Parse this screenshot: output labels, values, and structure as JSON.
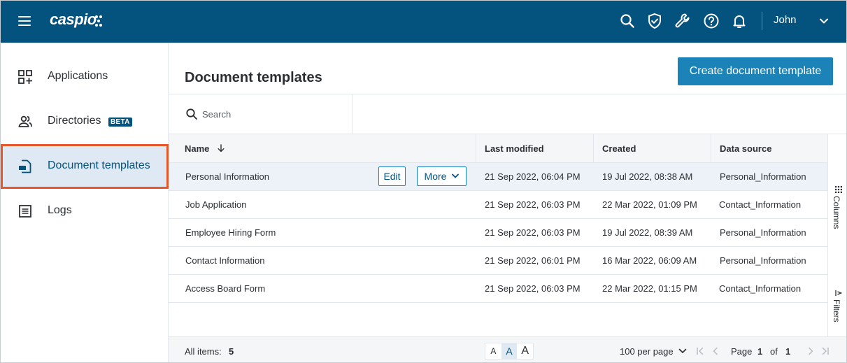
{
  "topbar": {
    "logo": "caspio",
    "icons": [
      "search-icon",
      "shield-check-icon",
      "wrench-icon",
      "help-icon",
      "bell-icon"
    ],
    "user_name": "John"
  },
  "sidebar": {
    "items": [
      {
        "label": "Applications",
        "icon": "apps-add-icon"
      },
      {
        "label": "Directories",
        "icon": "users-icon",
        "badge": "BETA"
      },
      {
        "label": "Document templates",
        "icon": "document-icon",
        "active": true
      },
      {
        "label": "Logs",
        "icon": "list-icon"
      }
    ]
  },
  "main": {
    "title": "Document templates",
    "create_button": "Create document template",
    "search_placeholder": "Search"
  },
  "table": {
    "columns": [
      "Name",
      "Last modified",
      "Created",
      "Data source"
    ],
    "sort_column": "Name",
    "sort_direction": "descending",
    "rows": [
      {
        "name": "Personal Information",
        "modified": "21 Sep 2022, 06:04 PM",
        "created": "19 Jul 2022, 08:38 AM",
        "source": "Personal_Information"
      },
      {
        "name": "Job Application",
        "modified": "21 Sep 2022, 06:03 PM",
        "created": "22 Mar 2022, 01:09 PM",
        "source": "Contact_Information"
      },
      {
        "name": "Employee Hiring Form",
        "modified": "21 Sep 2022, 06:03 PM",
        "created": "19 Jul 2022, 08:39 AM",
        "source": "Personal_Information"
      },
      {
        "name": "Contact Information",
        "modified": "21 Sep 2022, 06:01 PM",
        "created": "16 Mar 2022, 06:09 AM",
        "source": "Personal_Information"
      },
      {
        "name": "Access Board Form",
        "modified": "21 Sep 2022, 06:03 PM",
        "created": "22 Mar 2022, 01:15 PM",
        "source": "Contact_Information"
      }
    ],
    "row_actions": {
      "edit": "Edit",
      "more": "More"
    }
  },
  "side_panel": {
    "columns": "Columns",
    "filters": "Filters"
  },
  "footer": {
    "all_items_label": "All items:",
    "all_items_count": "5",
    "text_sizes": [
      "A",
      "A",
      "A"
    ],
    "per_page": "100 per page",
    "page_label": "Page",
    "page_current": "1",
    "page_of": "of",
    "page_total": "1"
  },
  "colors": {
    "topbar": "#04527e",
    "accent": "#1b83b8",
    "active_outline": "#e5582a",
    "active_bg": "#dfe9f3"
  }
}
